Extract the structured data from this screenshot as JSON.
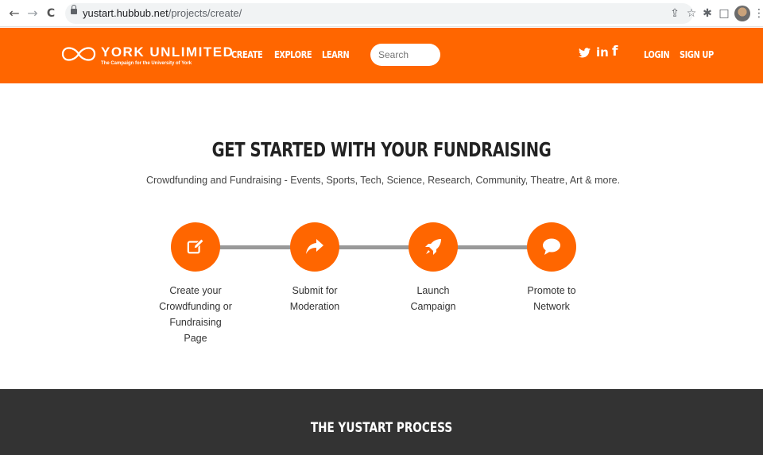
{
  "browser": {
    "url_host": "yustart.hubbub.net",
    "url_path": "/projects/create/",
    "back_glyph": "←",
    "forward_glyph": "→",
    "reload_glyph": "C",
    "share_glyph": "⇪",
    "star_glyph": "☆",
    "extensions_glyph": "✱",
    "sidepanel_glyph": "□",
    "menu_glyph": "⋮"
  },
  "header": {
    "background": "#ff6600",
    "logo_title": "YORK UNLIMITED",
    "logo_subtitle": "The Campaign for the University of York",
    "nav": [
      "CREATE",
      "EXPLORE",
      "LEARN"
    ],
    "search_placeholder": "Search",
    "social": {
      "twitter": "🐦",
      "linkedin": "in",
      "facebook": "f"
    },
    "login_label": "LOGIN",
    "signup_label": "SIGN UP"
  },
  "hero": {
    "title": "GET STARTED WITH YOUR FUNDRAISING",
    "subtitle": "Crowdfunding and Fundraising - Events, Sports, Tech, Science, Research, Community, Theatre, Art & more."
  },
  "steps": [
    {
      "icon": "edit-icon",
      "label": "Create your Crowdfunding or Fundraising Page"
    },
    {
      "icon": "share-arrow-icon",
      "label": "Submit for Moderation"
    },
    {
      "icon": "rocket-icon",
      "label": "Launch Campaign"
    },
    {
      "icon": "speech-bubble-icon",
      "label": "Promote to Network"
    }
  ],
  "process": {
    "title": "THE YUSTART PROCESS",
    "background": "#333333"
  }
}
